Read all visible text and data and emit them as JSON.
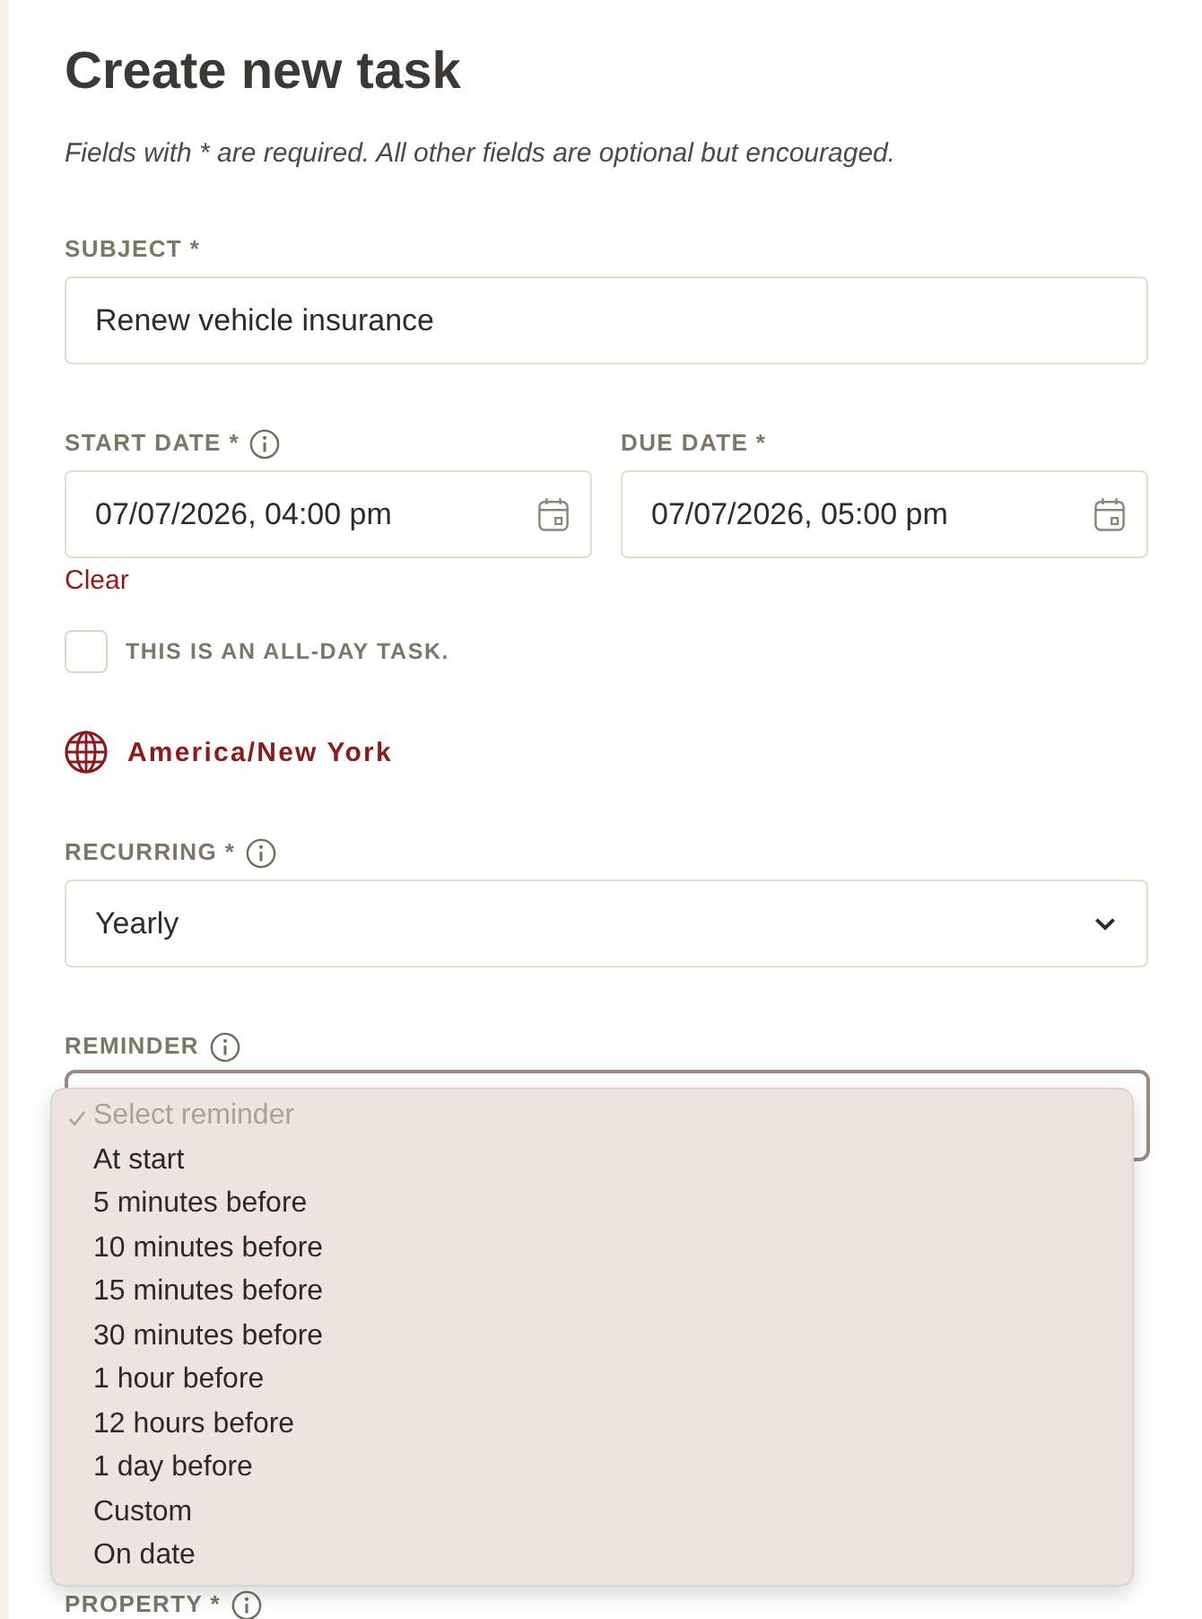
{
  "title": "Create new task",
  "subtitle": "Fields with * are required. All other fields are optional but encouraged.",
  "subject": {
    "label": "SUBJECT *",
    "info": false,
    "value": "Renew vehicle insurance"
  },
  "dates": [
    {
      "label": "START DATE *",
      "info": true,
      "value": "07/07/2026, 04:00 pm"
    },
    {
      "label": "DUE DATE *",
      "info": false,
      "value": "07/07/2026, 05:00 pm"
    }
  ],
  "clear_link": "Clear",
  "all_day": {
    "label": "THIS IS AN ALL-DAY TASK.",
    "checked": false
  },
  "timezone": "America/New York",
  "recurring": {
    "label": "RECURRING *",
    "info": true,
    "value": "Yearly",
    "focused": false
  },
  "reminder": {
    "label": "REMINDER",
    "info": true,
    "focused": true,
    "open": true,
    "options": [
      {
        "label": "Select reminder",
        "selected": true,
        "disabled": true
      },
      {
        "label": "At start",
        "selected": false,
        "disabled": false
      },
      {
        "label": "5 minutes before",
        "selected": false,
        "disabled": false
      },
      {
        "label": "10 minutes before",
        "selected": false,
        "disabled": false
      },
      {
        "label": "15 minutes before",
        "selected": false,
        "disabled": false
      },
      {
        "label": "30 minutes before",
        "selected": false,
        "disabled": false
      },
      {
        "label": "1 hour before",
        "selected": false,
        "disabled": false
      },
      {
        "label": "12 hours before",
        "selected": false,
        "disabled": false
      },
      {
        "label": "1 day before",
        "selected": false,
        "disabled": false
      },
      {
        "label": "Custom",
        "selected": false,
        "disabled": false
      },
      {
        "label": "On date",
        "selected": false,
        "disabled": false
      }
    ]
  },
  "property": {
    "label": "PROPERTY *",
    "info": true
  }
}
